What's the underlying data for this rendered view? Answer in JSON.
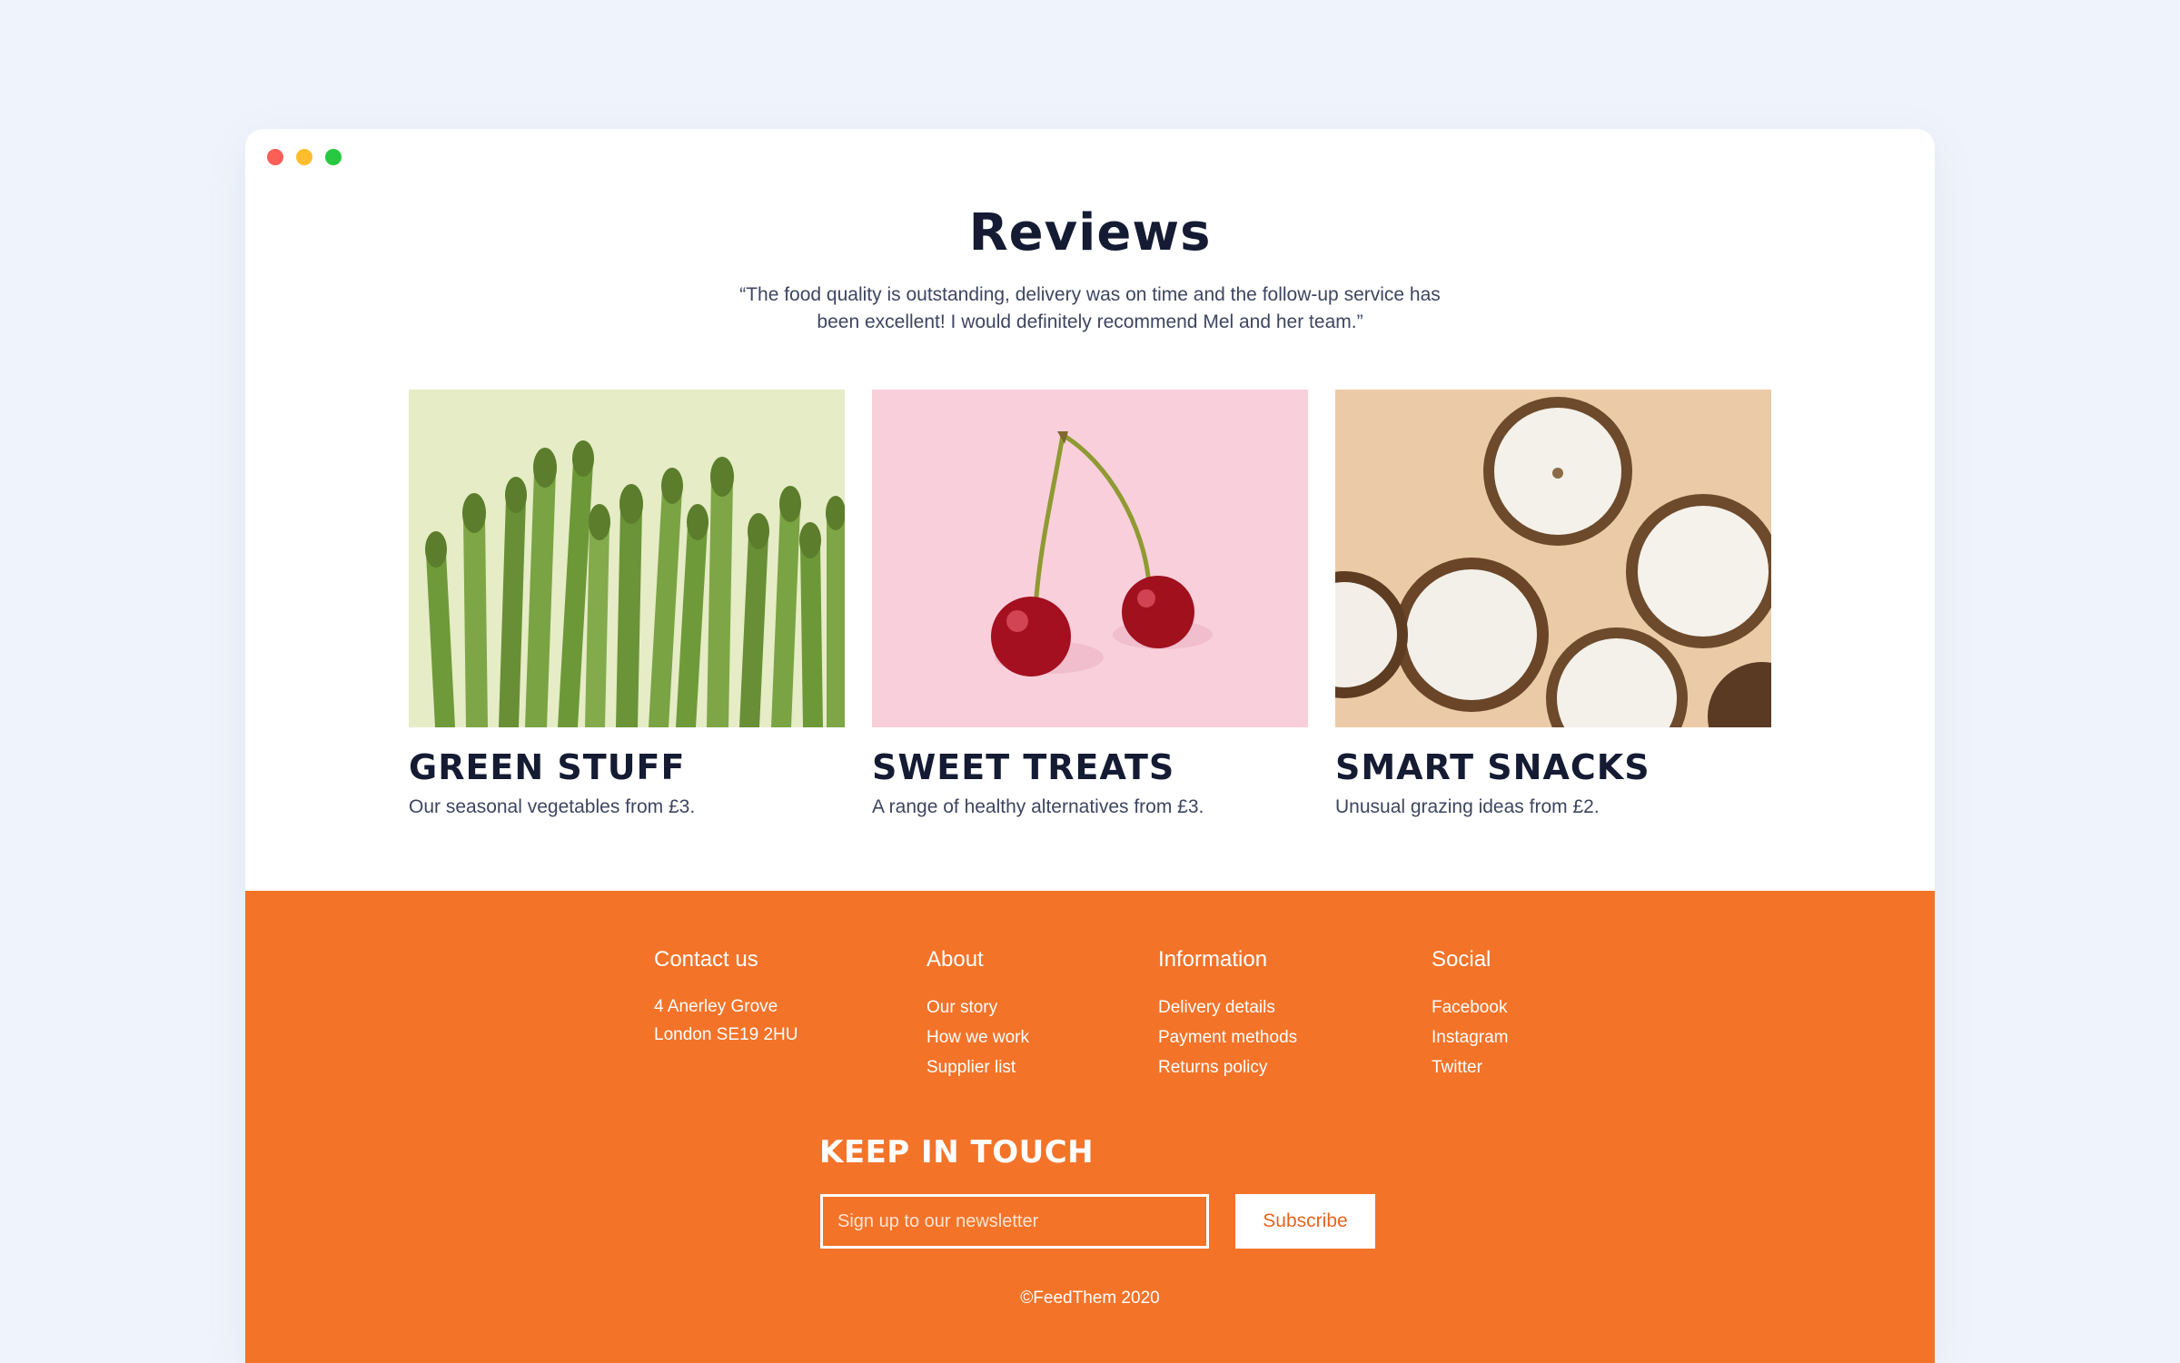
{
  "reviews": {
    "title": "Reviews",
    "quote": "“The food quality is outstanding, delivery was on time and the follow-up service has been excellent! I would definitely recommend Mel and her team.”"
  },
  "cards": [
    {
      "title": "GREEN STUFF",
      "description": "Our seasonal vegetables from £3.",
      "image_icon": "asparagus-photo"
    },
    {
      "title": "SWEET TREATS",
      "description": "A range of healthy alternatives from £3.",
      "image_icon": "cherries-photo"
    },
    {
      "title": "SMART SNACKS",
      "description": "Unusual grazing ideas from £2.",
      "image_icon": "coconuts-photo"
    }
  ],
  "footer": {
    "contact": {
      "heading": "Contact us",
      "lines": [
        "4 Anerley Grove",
        "London SE19 2HU"
      ]
    },
    "about": {
      "heading": "About",
      "links": [
        "Our story",
        "How we work",
        "Supplier list"
      ]
    },
    "information": {
      "heading": "Information",
      "links": [
        "Delivery details",
        "Payment methods",
        "Returns policy"
      ]
    },
    "social": {
      "heading": "Social",
      "links": [
        "Facebook",
        "Instagram",
        "Twitter"
      ]
    },
    "newsletter": {
      "title": "KEEP IN TOUCH",
      "placeholder": "Sign up to our newsletter",
      "button": "Subscribe"
    },
    "copyright": "©FeedThem 2020"
  },
  "colors": {
    "page_bg": "#eff4fc",
    "footer_bg": "#f37329",
    "heading_text": "#141b33",
    "body_text": "#3e4560"
  }
}
